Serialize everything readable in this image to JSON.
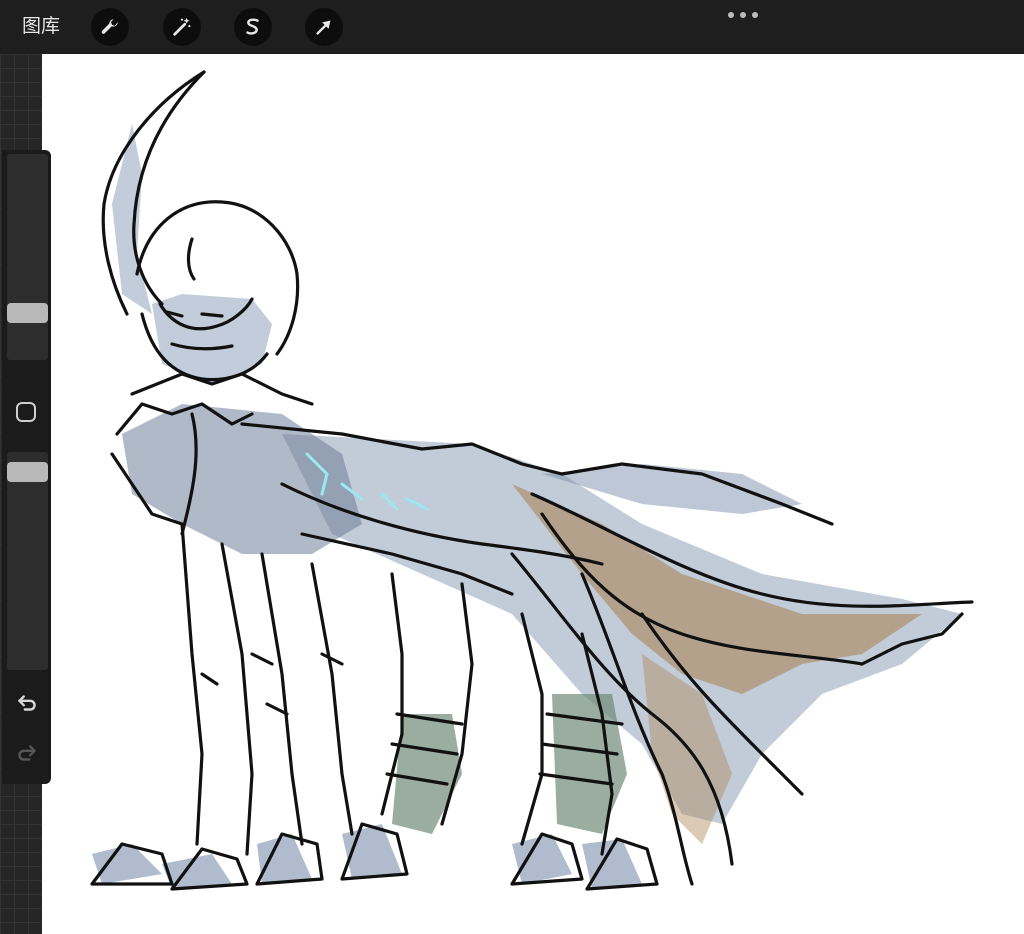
{
  "toolbar": {
    "gallery_label": "图库",
    "tools": [
      "wrench-icon",
      "magic-wand-icon",
      "selection-s-icon",
      "transform-arrow-icon"
    ]
  },
  "sidebar": {
    "brush_size_level": 0.8,
    "opacity_level": 0.95,
    "buttons": [
      "modify-square-icon",
      "undo-icon",
      "redo-icon"
    ]
  },
  "colors": {
    "toolbar_bg": "#1e1e1e",
    "canvas_bg": "#ffffff",
    "ink": "#111111",
    "wash_blue": "#7b8fae",
    "wash_brown": "#a98659",
    "wash_green": "#6f8a78",
    "accent_cyan": "#9be8ee"
  }
}
